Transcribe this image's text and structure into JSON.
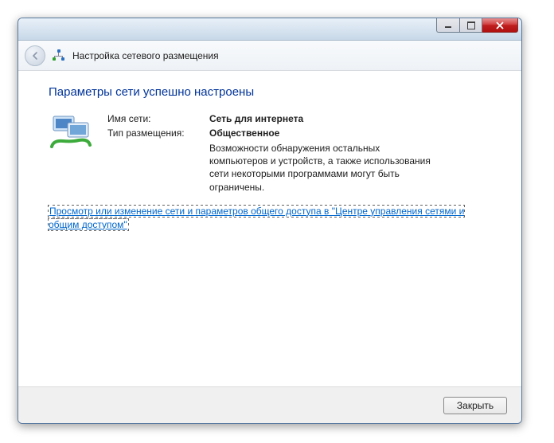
{
  "header": {
    "title": "Настройка сетевого размещения"
  },
  "main": {
    "heading": "Параметры сети успешно настроены",
    "network_name_label": "Имя сети:",
    "network_name_value": "Сеть для интернета",
    "location_type_label": "Тип размещения:",
    "location_type_value": "Общественное",
    "location_desc": "Возможности обнаружения остальных компьютеров и устройств, а также использования сети некоторыми программами могут быть ограничены.",
    "link_text": "Просмотр или изменение сети и параметров общего доступа в \"Центре управления сетями и общим доступом\""
  },
  "footer": {
    "close_label": "Закрыть"
  }
}
